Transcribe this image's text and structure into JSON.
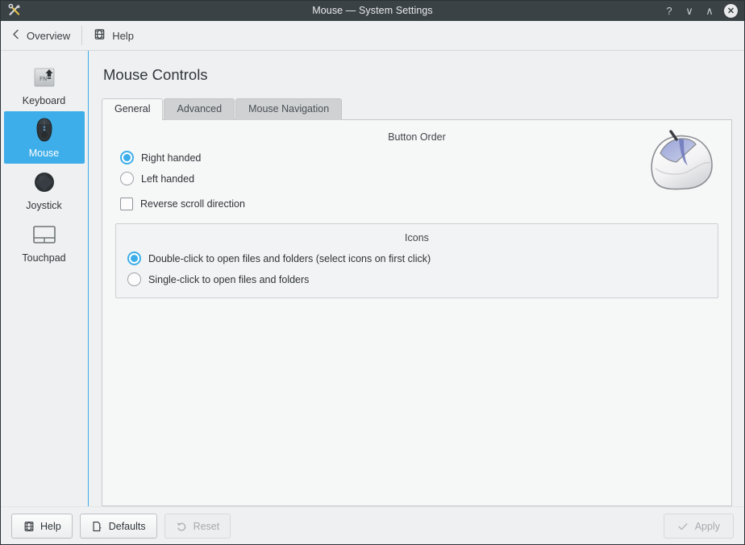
{
  "titlebar": {
    "title": "Mouse — System Settings",
    "app_icon": "tools-icon",
    "buttons": [
      {
        "name": "help",
        "glyph": "?"
      },
      {
        "name": "minimize",
        "glyph": "∨"
      },
      {
        "name": "maximize",
        "glyph": "∧"
      },
      {
        "name": "close",
        "glyph": "✕"
      }
    ]
  },
  "toolbar": {
    "overview_label": "Overview",
    "help_label": "Help"
  },
  "sidebar": {
    "items": [
      {
        "label": "Keyboard",
        "icon": "keyboard-fn-key-icon",
        "selected": false
      },
      {
        "label": "Mouse",
        "icon": "mouse-icon",
        "selected": true
      },
      {
        "label": "Joystick",
        "icon": "joystick-icon",
        "selected": false
      },
      {
        "label": "Touchpad",
        "icon": "touchpad-icon",
        "selected": false
      }
    ]
  },
  "main": {
    "page_title": "Mouse Controls",
    "tabs": [
      {
        "label": "General",
        "active": true
      },
      {
        "label": "Advanced",
        "active": false
      },
      {
        "label": "Mouse Navigation",
        "active": false
      }
    ],
    "button_order": {
      "group_title": "Button Order",
      "options": [
        {
          "label": "Right handed",
          "checked": true
        },
        {
          "label": "Left handed",
          "checked": false
        }
      ]
    },
    "reverse_scroll": {
      "label": "Reverse scroll direction",
      "checked": false
    },
    "icons_group": {
      "group_title": "Icons",
      "options": [
        {
          "label": "Double-click to open files and folders (select icons on first click)",
          "checked": true
        },
        {
          "label": "Single-click to open files and folders",
          "checked": false
        }
      ]
    },
    "illustration": "mouse-illustration"
  },
  "footer": {
    "help_label": "Help",
    "defaults_label": "Defaults",
    "reset_label": "Reset",
    "apply_label": "Apply"
  },
  "colors": {
    "accent": "#3daee9",
    "titlebar": "#3b4245",
    "window_bg": "#eff0f1",
    "panel_bg": "#f6f7f7",
    "text": "#31363b"
  }
}
